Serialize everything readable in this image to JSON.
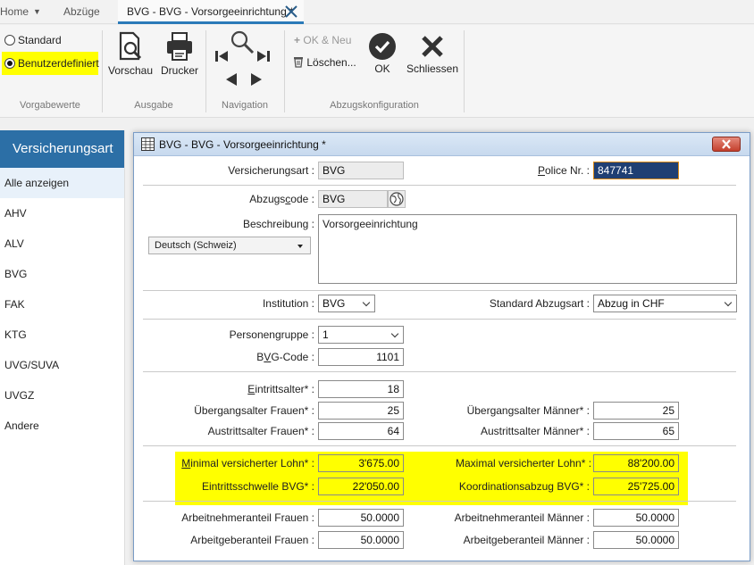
{
  "tabs": {
    "home": "Home",
    "abzuege": "Abzüge",
    "active": "BVG - BVG - Vorsorgeeinrichtung *"
  },
  "ribbon": {
    "vorgabewerte": {
      "label": "Vorgabewerte",
      "standard": "Standard",
      "benutzerdefiniert": "Benutzerdefiniert"
    },
    "ausgabe": {
      "label": "Ausgabe",
      "vorschau": "Vorschau",
      "drucker": "Drucker"
    },
    "navigation": {
      "label": "Navigation"
    },
    "abzugskonfiguration": {
      "label": "Abzugskonfiguration",
      "ok_neu": "OK & Neu",
      "loeschen": "Löschen...",
      "ok": "OK",
      "schliessen": "Schliessen"
    }
  },
  "sidebar": {
    "title": "Versicherungsart",
    "items": [
      "Alle anzeigen",
      "AHV",
      "ALV",
      "BVG",
      "FAK",
      "KTG",
      "UVG/SUVA",
      "UVGZ",
      "Andere"
    ]
  },
  "dialog": {
    "title": "BVG - BVG - Vorsorgeeinrichtung *",
    "versicherungsart": {
      "label": "Versicherungsart :",
      "value": "BVG"
    },
    "police": {
      "label_pre": "",
      "label_u": "P",
      "label_post": "olice Nr. :",
      "value": "847741"
    },
    "abzugscode": {
      "label_pre": "Abzugs",
      "label_u": "c",
      "label_post": "ode :",
      "value": "BVG"
    },
    "beschreibung": {
      "label": "Beschreibung :",
      "value": "Vorsorgeeinrichtung",
      "language": "Deutsch (Schweiz)"
    },
    "institution": {
      "label": "Institution :",
      "value": "BVG"
    },
    "standard_abzugsart": {
      "label": "Standard Abzugsart :",
      "value": "Abzug in CHF"
    },
    "personengruppe": {
      "label": "Personengruppe :",
      "value": "1"
    },
    "bvg_code": {
      "label_pre": "B",
      "label_u": "V",
      "label_post": "G-Code :",
      "value": "1101"
    },
    "eintrittsalter": {
      "label_pre": "",
      "label_u": "E",
      "label_post": "intrittsalter* :",
      "value": "18"
    },
    "uebergangsalter_frauen": {
      "label": "Übergangsalter Frauen* :",
      "value": "25"
    },
    "uebergangsalter_maenner": {
      "label": "Übergangsalter Männer* :",
      "value": "25"
    },
    "austrittsalter_frauen": {
      "label": "Austrittsalter Frauen* :",
      "value": "64"
    },
    "austrittsalter_maenner": {
      "label": "Austrittsalter Männer* :",
      "value": "65"
    },
    "minimal_lohn": {
      "label_pre": "",
      "label_u": "M",
      "label_post": "inimal versicherter Lohn* :",
      "value": "3'675.00"
    },
    "maximal_lohn": {
      "label": "Maximal versicherter Lohn* :",
      "value": "88'200.00"
    },
    "eintrittsschwelle": {
      "label": "Eintrittsschwelle BVG* :",
      "value": "22'050.00"
    },
    "koordinationsabzug": {
      "label": "Koordinationsabzug BVG* :",
      "value": "25'725.00"
    },
    "an_frauen": {
      "label": "Arbeitnehmeranteil Frauen :",
      "value": "50.0000"
    },
    "an_maenner": {
      "label": "Arbeitnehmeranteil Männer :",
      "value": "50.0000"
    },
    "ag_frauen": {
      "label": "Arbeitgeberanteil Frauen :",
      "value": "50.0000"
    },
    "ag_maenner": {
      "label": "Arbeitgeberanteil Männer :",
      "value": "50.0000"
    }
  },
  "colors": {
    "accent": "#2c6fa6",
    "highlight": "#ffff00",
    "selection": "#1f3f73"
  }
}
